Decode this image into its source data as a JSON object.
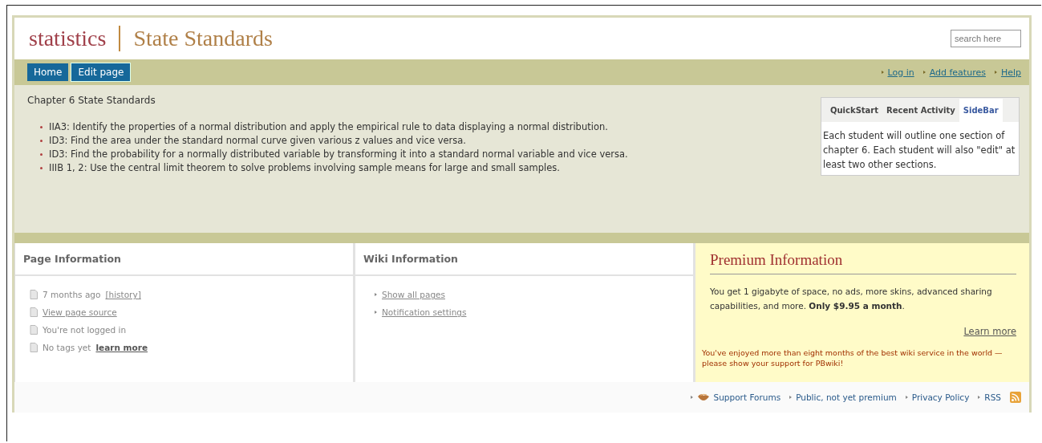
{
  "header": {
    "wiki_name": "statistics",
    "page_title": "State Standards",
    "search": {
      "placeholder": "search here"
    }
  },
  "nav": {
    "buttons": [
      {
        "label": "Home"
      },
      {
        "label": "Edit page"
      }
    ],
    "links": [
      "Log in",
      "Add features",
      "Help"
    ]
  },
  "content": {
    "heading": "Chapter 6 State Standards",
    "standards": [
      "IIA3: Identify the properties of a normal distribution and apply the empirical rule to data displaying a normal distribution.",
      "ID3: Find the area under the standard normal curve given various z values and vice versa.",
      "ID3: Find the probability for a normally distributed variable by transforming it into a standard normal variable and vice versa.",
      "IIIB 1, 2: Use the central limit theorem to solve problems involving sample means for large and small samples."
    ]
  },
  "sidebar": {
    "tabs": [
      {
        "label": "QuickStart",
        "selected": false
      },
      {
        "label": "Recent Activity",
        "selected": false
      },
      {
        "label": "SideBar",
        "selected": true
      }
    ],
    "text": "Each student will outline one section of chapter 6. Each student will also \"edit\" at least two other sections."
  },
  "page_information": {
    "title": "Page Information",
    "items": [
      {
        "text": "7 months ago",
        "link": "[history]",
        "link_bold": false
      },
      {
        "link": "View page source",
        "link_bold": false
      },
      {
        "text": "You're not logged in"
      },
      {
        "text": "No tags yet",
        "link": "learn more",
        "link_bold": true
      }
    ]
  },
  "wiki_information": {
    "title": "Wiki Information",
    "links": [
      "Show all pages",
      "Notification settings"
    ]
  },
  "premium_information": {
    "title": "Premium Information",
    "body": "You get 1 gigabyte of space, no ads, more skins, advanced sharing capabilities, and more. **Only $9.95 a month**.",
    "learn_more": "Learn more",
    "notice": "You've enjoyed more than eight months of the best wiki service in the world — please show your support for PBwiki!"
  },
  "footer": {
    "links": [
      "Support Forums",
      "Public, not yet premium",
      "Privacy Policy",
      "RSS"
    ]
  }
}
